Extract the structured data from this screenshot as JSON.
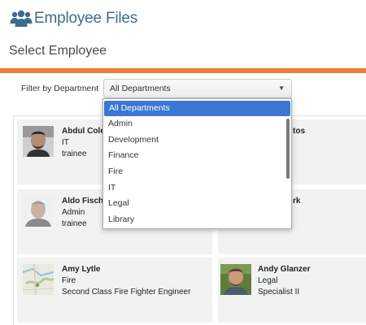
{
  "app": {
    "title": "Employee Files",
    "icon": "people-icon"
  },
  "page": {
    "title": "Select Employee"
  },
  "colors": {
    "accent_bar": "#ee7b3a",
    "title": "#3f6b8c",
    "selection": "#3a78d4"
  },
  "filter": {
    "label": "Filter by Department",
    "selected": "All Departments",
    "options": [
      "All Departments",
      "Admin",
      "Development",
      "Finance",
      "Fire",
      "IT",
      "Legal",
      "Library"
    ]
  },
  "employees": [
    {
      "name": "Abdul Cole",
      "department": "IT",
      "title": "trainee"
    },
    {
      "name": "Aldo Fischer",
      "department": "Admin",
      "title": "trainee"
    },
    {
      "name": "Amy Lytle",
      "department": "Fire",
      "title": "Second Class Fire Fighter Engineer"
    },
    {
      "name": "Andy Glanzer",
      "department": "Legal",
      "title": "Specialist II"
    }
  ],
  "partial_names": [
    "tos",
    "rk"
  ]
}
